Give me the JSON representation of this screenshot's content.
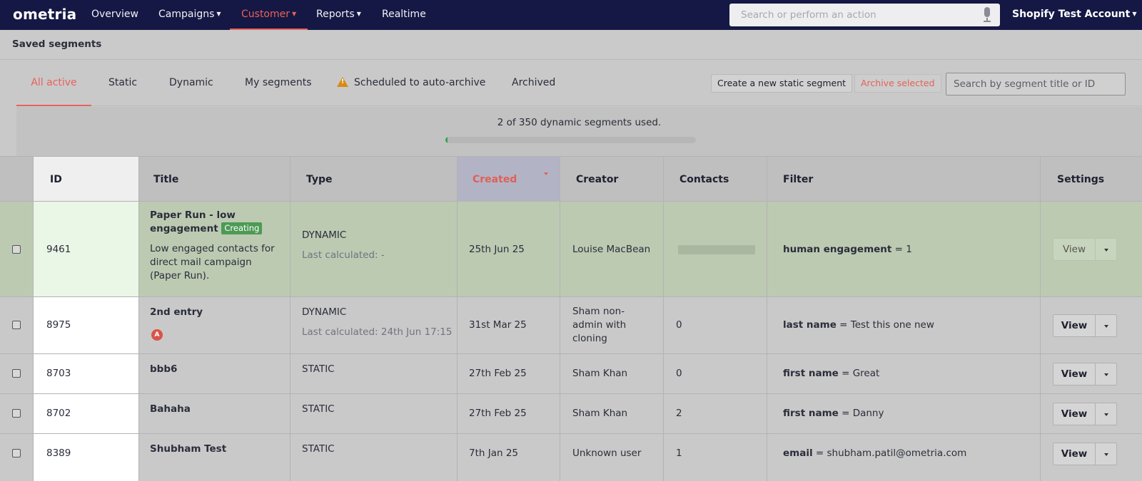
{
  "nav": {
    "logo": "ometria",
    "items": [
      {
        "label": "Overview",
        "has_caret": false
      },
      {
        "label": "Campaigns",
        "has_caret": true
      },
      {
        "label": "Customer",
        "has_caret": true
      },
      {
        "label": "Reports",
        "has_caret": true
      },
      {
        "label": "Realtime",
        "has_caret": false
      }
    ],
    "active": "Customer",
    "search_placeholder": "Search or perform an action",
    "account": "Shopify Test Account"
  },
  "page": {
    "title": "Saved segments"
  },
  "tabs": {
    "items": [
      "All active",
      "Static",
      "Dynamic",
      "My segments",
      "Scheduled to auto-archive",
      "Archived"
    ],
    "active": "All active"
  },
  "actions": {
    "create_label": "Create a new static segment",
    "archive_label": "Archive selected",
    "search_placeholder": "Search by segment title or ID"
  },
  "usage": {
    "text": "2 of 350 dynamic segments used.",
    "used": 2,
    "total": 350,
    "accent": "#36a24c"
  },
  "table": {
    "headers": {
      "id": "ID",
      "title": "Title",
      "type": "Type",
      "created": "Created",
      "creator": "Creator",
      "contacts": "Contacts",
      "filter": "Filter",
      "settings": "Settings"
    },
    "sorted_by": "Created",
    "rows": [
      {
        "id": "9461",
        "title_line1": "Paper Run - low",
        "title_line2": "engagement",
        "badge": "Creating",
        "description": "Low engaged contacts for direct mail campaign (Paper Run).",
        "type": "DYNAMIC",
        "last_calculated": "Last calculated: -",
        "created": "25th Jun 25",
        "creator": "Louise MacBean",
        "contacts": "",
        "filter_field": "human engagement",
        "filter_value": "= 1",
        "view_label": "View"
      },
      {
        "id": "8975",
        "title": "2nd entry",
        "avatar": "A",
        "type": "DYNAMIC",
        "last_calculated": "Last calculated: 24th Jun 17:15",
        "created": "31st Mar 25",
        "creator": "Sham non-admin with cloning",
        "contacts": "0",
        "filter_field": "last name",
        "filter_value": "= Test this one new",
        "view_label": "View"
      },
      {
        "id": "8703",
        "title": "bbb6",
        "type": "STATIC",
        "created": "27th Feb 25",
        "creator": "Sham Khan",
        "contacts": "0",
        "filter_field": "first name",
        "filter_value": "= Great",
        "view_label": "View"
      },
      {
        "id": "8702",
        "title": "Bahaha",
        "type": "STATIC",
        "created": "27th Feb 25",
        "creator": "Sham Khan",
        "contacts": "2",
        "filter_field": "first name",
        "filter_value": "= Danny",
        "view_label": "View"
      },
      {
        "id": "8389",
        "title": "Shubham Test",
        "type": "STATIC",
        "created": "7th Jan 25",
        "creator": "Unknown user",
        "contacts": "1",
        "filter_field": "email",
        "filter_value": "= shubham.patil@ometria.com",
        "view_label": "View"
      }
    ]
  }
}
